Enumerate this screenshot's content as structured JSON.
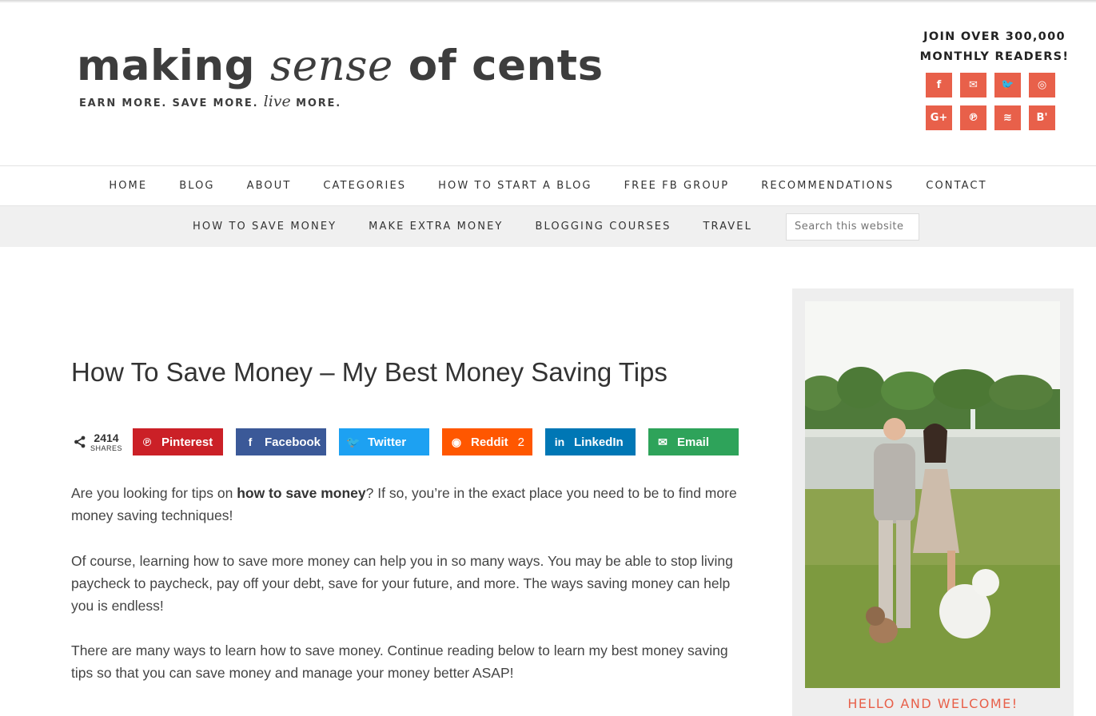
{
  "header": {
    "logo_part1": "making ",
    "logo_part2": "sense",
    "logo_part3": " of cents",
    "tagline_part1": "EARN MORE. SAVE MORE. ",
    "tagline_live": "live",
    "tagline_part2": " MORE.",
    "join_line1": "JOIN OVER 300,000",
    "join_line2": "MONTHLY READERS!",
    "social_icons": [
      {
        "name": "facebook-icon",
        "glyph": "f"
      },
      {
        "name": "email-icon",
        "glyph": "✉"
      },
      {
        "name": "twitter-icon",
        "glyph": "🐦"
      },
      {
        "name": "instagram-icon",
        "glyph": "◎"
      },
      {
        "name": "google-plus-icon",
        "glyph": "G+"
      },
      {
        "name": "pinterest-icon",
        "glyph": "℗"
      },
      {
        "name": "rss-icon",
        "glyph": "≋"
      },
      {
        "name": "bloglovin-icon",
        "glyph": "B'"
      }
    ],
    "accent_color": "#e8604a"
  },
  "nav_primary": [
    "HOME",
    "BLOG",
    "ABOUT",
    "CATEGORIES",
    "HOW TO START A BLOG",
    "FREE FB GROUP",
    "RECOMMENDATIONS",
    "CONTACT"
  ],
  "nav_secondary": [
    "HOW TO SAVE MONEY",
    "MAKE EXTRA MONEY",
    "BLOGGING COURSES",
    "TRAVEL"
  ],
  "search": {
    "placeholder": "Search this website"
  },
  "article": {
    "title": "How To Save Money – My Best Money Saving Tips",
    "share_total": "2414",
    "share_label": "SHARES",
    "share_buttons": [
      {
        "label": "Pinterest",
        "icon": "pinterest-icon",
        "glyph": "℗",
        "color": "#cb2027",
        "count": ""
      },
      {
        "label": "Facebook",
        "icon": "facebook-icon",
        "glyph": "f",
        "color": "#3b5998",
        "count": ""
      },
      {
        "label": "Twitter",
        "icon": "twitter-icon",
        "glyph": "🐦",
        "color": "#1da1f2",
        "count": ""
      },
      {
        "label": "Reddit",
        "icon": "reddit-icon",
        "glyph": "◉",
        "color": "#ff5700",
        "count": "2"
      },
      {
        "label": "LinkedIn",
        "icon": "linkedin-icon",
        "glyph": "in",
        "color": "#0077b5",
        "count": ""
      },
      {
        "label": "Email",
        "icon": "email-icon",
        "glyph": "✉",
        "color": "#2ea35a",
        "count": ""
      }
    ],
    "p1_before": "Are you looking for tips on ",
    "p1_bold": "how to save money",
    "p1_after": "? If so, you’re in the exact place you need to be to find more money saving techniques!",
    "p2": "Of course, learning how to save more money can help you in so many ways. You may be able to stop living paycheck to paycheck, pay off your debt, save for your future, and more. The ways saving money can help you is endless!",
    "p3": "There are many ways to learn how to save money. Continue reading below to learn my best money saving tips so that you can save money and manage your money better ASAP!"
  },
  "sidebar": {
    "welcome": "HELLO AND WELCOME!"
  }
}
